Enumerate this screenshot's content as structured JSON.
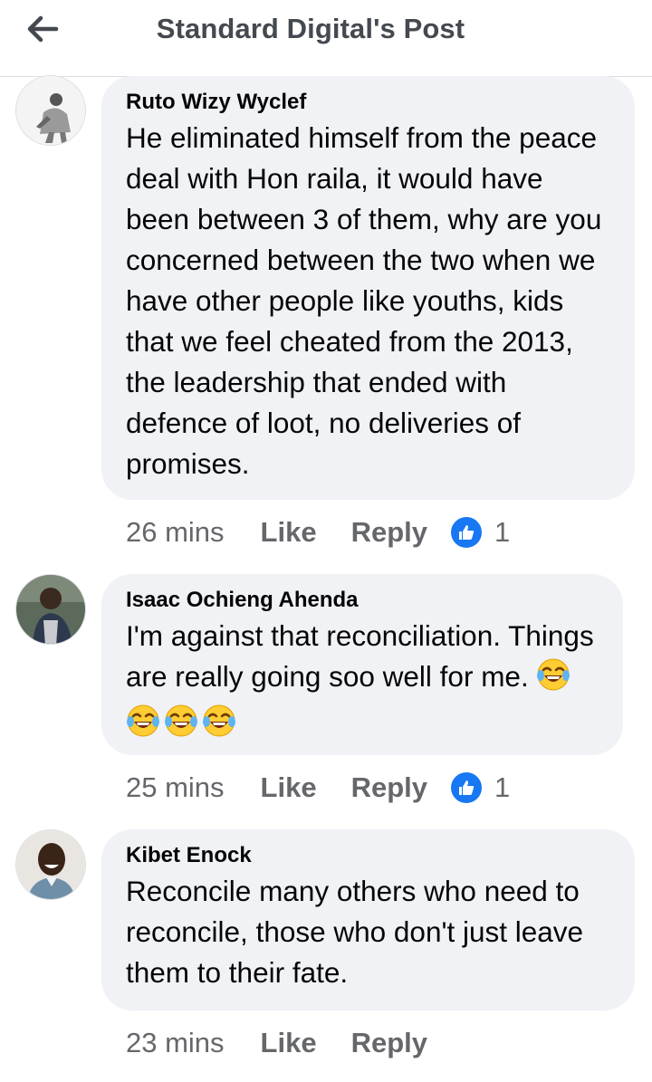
{
  "header": {
    "title": "Standard Digital's Post",
    "back_icon": "arrow-left-icon"
  },
  "colors": {
    "bubble": "#f0f2f5",
    "meta_text": "#65676b",
    "like_blue": "#1877f2",
    "header_text": "#444950"
  },
  "comments": [
    {
      "author": "Ruto Wizy Wyclef",
      "text": "He eliminated himself from the peace deal with Hon raila, it would have been between 3 of them, why are you concerned between the two when we have other people like youths, kids that we feel cheated from the 2013, the leadership that ended with defence of loot, no deliveries of promises.",
      "time": "26 mins",
      "like_label": "Like",
      "reply_label": "Reply",
      "reaction_count": "1"
    },
    {
      "author": "Isaac Ochieng Ahenda",
      "text": "I'm against that reconciliation. Things are really going soo well for me.",
      "emoji": "tears-of-joy x4",
      "time": "25 mins",
      "like_label": "Like",
      "reply_label": "Reply",
      "reaction_count": "1"
    },
    {
      "author": "Kibet Enock",
      "text": "Reconcile many others who need to reconcile, those who don't just leave them to their fate.",
      "time": "23 mins",
      "like_label": "Like",
      "reply_label": "Reply"
    }
  ]
}
